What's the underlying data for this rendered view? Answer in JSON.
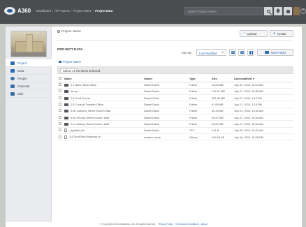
{
  "topbar": {
    "brand": "A360",
    "breadcrumbs": [
      "Dashboard",
      "All Projects",
      "Project Name",
      "Project Data"
    ],
    "breadcrumb_separator": "/",
    "search_placeholder": "Search Project Name",
    "help_label": "?"
  },
  "sidebar": {
    "items": [
      {
        "label": "Project",
        "icon": "project-icon",
        "color": "#2d6bb5",
        "active": true
      },
      {
        "label": "Data",
        "icon": "data-icon",
        "color": "#2d6bb5",
        "active": false
      },
      {
        "label": "People",
        "icon": "people-icon",
        "color": "#3a6ea5",
        "active": false
      },
      {
        "label": "Calendar",
        "icon": "calendar-icon",
        "color": "#3a6ea5",
        "active": false
      },
      {
        "label": "Wiki",
        "icon": "wiki-icon",
        "color": "#3a6ea5",
        "active": false
      }
    ]
  },
  "main": {
    "project_name": "Project Name",
    "upload_label": "Upload",
    "create_label": "Create",
    "section_title": "PROJECT DATA",
    "sort_by_label": "Sort By",
    "sort_value": "Last Modified",
    "new_folder_label": "New Folder",
    "sub_breadcrumb": "Project Name",
    "select_all_label": "Select All",
    "no_items_label": "No items selected."
  },
  "table": {
    "headers": {
      "name": "Name",
      "owner": "Owner",
      "type": "Type",
      "size": "Size",
      "modified": "Last modified"
    },
    "rows": [
      {
        "name": "2.1 Bank Stock Office",
        "owner": "Daniel Davis",
        "type": "Folder",
        "size": "44.84 MB",
        "modified": "July 23, 2010, 11:04 AM",
        "kind": "folder"
      },
      {
        "name": "dump",
        "owner": "Daniel Davis",
        "type": "Folder",
        "size": "145.01 MB",
        "modified": "July 21, 2010, 10:35 AM",
        "kind": "folder"
      },
      {
        "name": "2.5 Tivoli Corner",
        "owner": "Daniel Davis",
        "type": "Folder",
        "size": "551.56 MB",
        "modified": "July 21, 2010, 1:15 PM",
        "kind": "folder"
      },
      {
        "name": "2.8 Consols Transfer Office",
        "owner": "Daniel Davis",
        "type": "Folder",
        "size": "61.98 MB",
        "modified": "July 21, 2010, 1:14 PM",
        "kind": "folder"
      },
      {
        "name": "5.5b Lothbury Street Screen Wall",
        "owner": "Daniel Davis",
        "type": "Folder",
        "size": "30.33 MB",
        "modified": "July 21, 2010, 10:54 AM",
        "kind": "folder"
      },
      {
        "name": "5.5d Princes Street Screen Wall",
        "owner": "Daniel Davis",
        "type": "Folder",
        "size": "30.97 MB",
        "modified": "July 21, 2010, 10:54 AM",
        "kind": "folder"
      },
      {
        "name": "2.9 Lothbury Street Screen Wall",
        "owner": "Daniel Davis",
        "type": "Folder",
        "size": "30.62 MB",
        "modified": "July 21, 2010, 10:54 AM",
        "kind": "folder"
      },
      {
        "name": "_applinks.txt",
        "owner": "Daniel Davis",
        "type": "TXT",
        "size": "141 B",
        "modified": "July 20, 2010, 10:31 AM",
        "kind": "doc"
      },
      {
        "name": "3.4 Tivoli Bird Windows.ifc",
        "owner": "andrew cocks",
        "type": "Others",
        "size": "449.90 KB",
        "modified": "July 16, 2010, 12:05 PM",
        "kind": "doc"
      }
    ]
  },
  "footer": {
    "copyright": "© Copyright 2014 Autodesk, Inc. All rights reserved.",
    "links": [
      "Privacy Policy",
      "Terms and Conditions",
      "About"
    ]
  }
}
